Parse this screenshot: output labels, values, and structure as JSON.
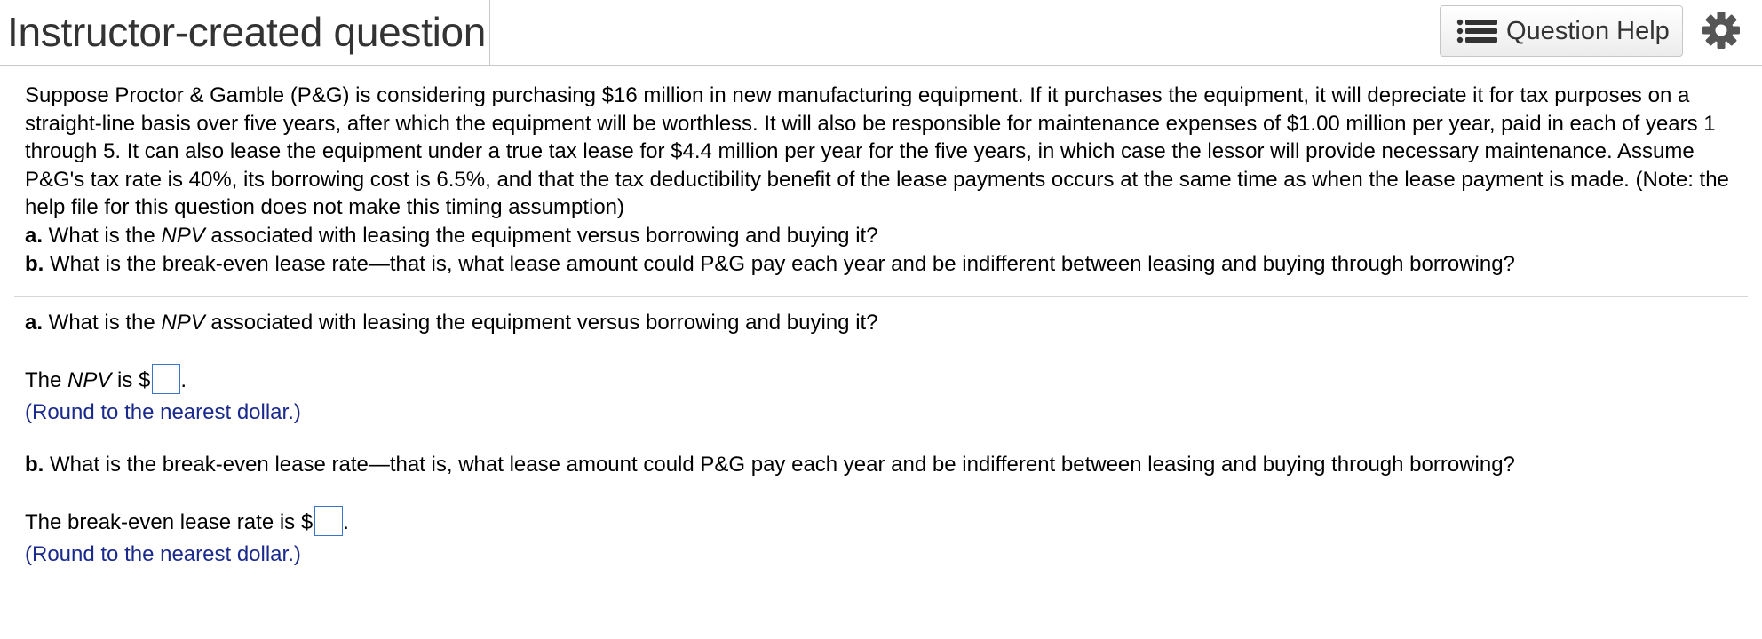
{
  "header": {
    "title": "Instructor-created question",
    "help_button_label": "Question Help",
    "help_icon": "list-icon",
    "settings_icon": "gear-icon"
  },
  "stem": {
    "paragraph": "Suppose Proctor & Gamble (P&G) is considering purchasing $16 million in new manufacturing equipment. If it purchases the equipment, it will depreciate it for tax purposes on a straight-line basis over five years, after which the equipment will be worthless. It will also be responsible for maintenance expenses of $1.00 million per year, paid in each of years 1 through 5. It can also lease the equipment under a true tax lease for $4.4 million per year for the five years, in which case the lessor will provide necessary maintenance. Assume P&G's tax rate is 40%, its borrowing cost is 6.5%, and that the tax deductibility benefit of the lease payments occurs at the same time as when the lease payment is made. (Note: the help file for this question does not make this timing assumption)",
    "part_a": {
      "label": "a.",
      "text_before": " What is the ",
      "italic": "NPV",
      "text_after": " associated with leasing the equipment versus borrowing and buying it?"
    },
    "part_b": {
      "label": "b.",
      "text": " What is the break-even lease rate—that is, what lease amount could P&G pay each year and be indifferent between leasing and buying through borrowing?"
    }
  },
  "part_a": {
    "question": {
      "label": "a.",
      "text_before": " What is the ",
      "italic": "NPV",
      "text_after": " associated with leasing the equipment versus borrowing and buying it?"
    },
    "answer_prefix_1": "The ",
    "answer_prefix_italic": "NPV",
    "answer_prefix_2": " is $",
    "answer_value": "",
    "answer_suffix": ".",
    "hint": "(Round to the nearest dollar.)"
  },
  "part_b": {
    "question": {
      "label": "b.",
      "text": " What is the break-even lease rate—that is, what lease amount could P&G pay each year and be indifferent between leasing and buying through borrowing?"
    },
    "answer_prefix": "The break-even lease rate is $",
    "answer_value": "",
    "answer_suffix": ".",
    "hint": "(Round to the nearest dollar.)"
  },
  "colors": {
    "hint_text": "#1a2a8c",
    "input_border": "#3a74c9",
    "title_text": "#333333"
  }
}
